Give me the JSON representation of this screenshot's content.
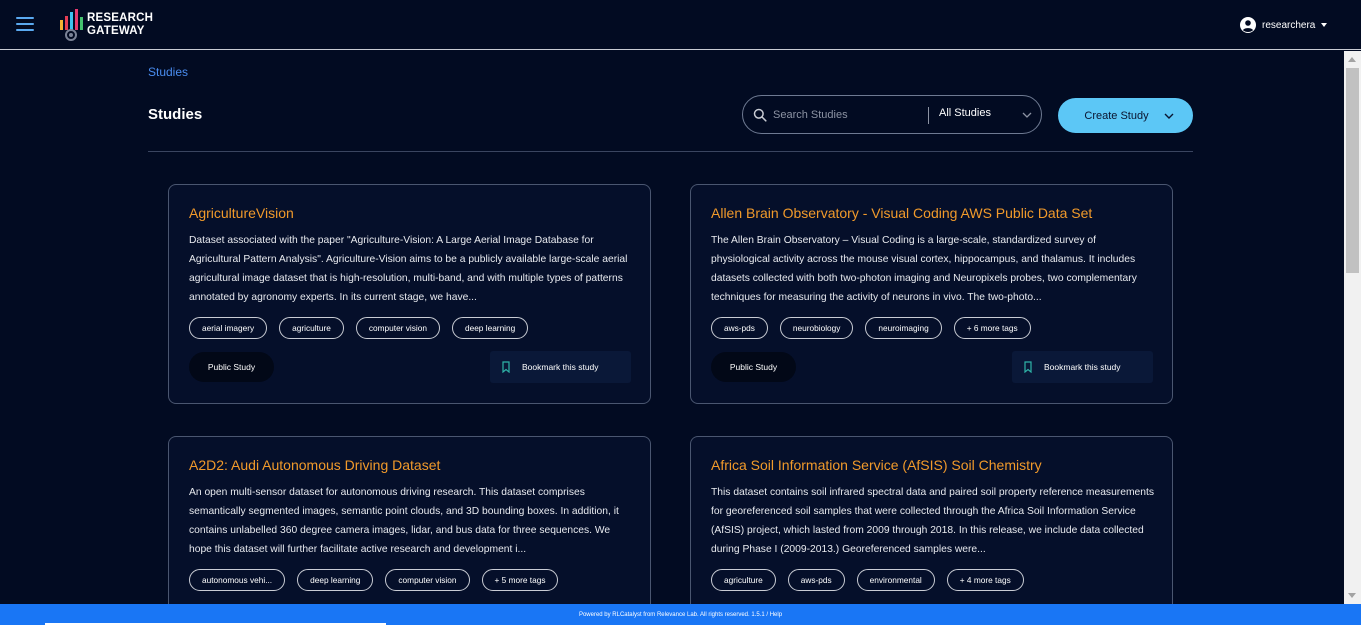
{
  "app": {
    "logo_line1": "RESEARCH",
    "logo_line2": "GATEWAY",
    "user_name": "researchera"
  },
  "breadcrumb": "Studies",
  "page_title": "Studies",
  "search": {
    "placeholder": "Search Studies",
    "filter_value": "All Studies"
  },
  "create_button": "Create Study",
  "cards": [
    {
      "title": "AgricultureVision",
      "description": "Dataset associated with the paper \"Agriculture-Vision: A Large Aerial Image Database for Agricultural Pattern Analysis\". Agriculture-Vision aims to be a publicly available large-scale aerial agricultural image dataset that is high-resolution, multi-band, and with multiple types of patterns annotated by agronomy experts. In its current stage, we have...",
      "tags": [
        "aerial imagery",
        "agriculture",
        "computer vision",
        "deep learning"
      ],
      "badge": "Public Study",
      "bookmark": "Bookmark this study"
    },
    {
      "title": "Allen Brain Observatory - Visual Coding AWS Public Data Set",
      "description": "The Allen Brain Observatory – Visual Coding is a large-scale, standardized survey of physiological activity across the mouse visual cortex, hippocampus, and thalamus. It includes datasets collected with both two-photon imaging and Neuropixels probes, two complementary techniques for measuring the activity of neurons in vivo. The two-photo...",
      "tags": [
        "aws-pds",
        "neurobiology",
        "neuroimaging",
        "+ 6 more tags"
      ],
      "badge": "Public Study",
      "bookmark": "Bookmark this study"
    },
    {
      "title": "A2D2: Audi Autonomous Driving Dataset",
      "description": "An open multi-sensor dataset for autonomous driving research. This dataset comprises semantically segmented images, semantic point clouds, and 3D bounding boxes. In addition, it contains unlabelled 360 degree camera images, lidar, and bus data for three sequences. We hope this dataset will further facilitate active research and development i...",
      "tags": [
        "autonomous vehi...",
        "deep learning",
        "computer vision",
        "+ 5 more tags"
      ]
    },
    {
      "title": "Africa Soil Information Service (AfSIS) Soil Chemistry",
      "description": "This dataset contains soil infrared spectral data and paired soil property reference measurements for georeferenced soil samples that were collected through the Africa Soil Information Service (AfSIS) project, which lasted from 2009 through 2018. In this release, we include data collected during Phase I (2009-2013.) Georeferenced samples were...",
      "tags": [
        "agriculture",
        "aws-pds",
        "environmental",
        "+ 4 more tags"
      ]
    }
  ],
  "footer": "Powered by RLCatalyst from Relevance Lab. All rights reserved. 1.5.1 / Help",
  "colors": {
    "background": "#020b22",
    "accent": "#5cc7f6",
    "title": "#f19a2b",
    "footer": "#1976f5"
  }
}
